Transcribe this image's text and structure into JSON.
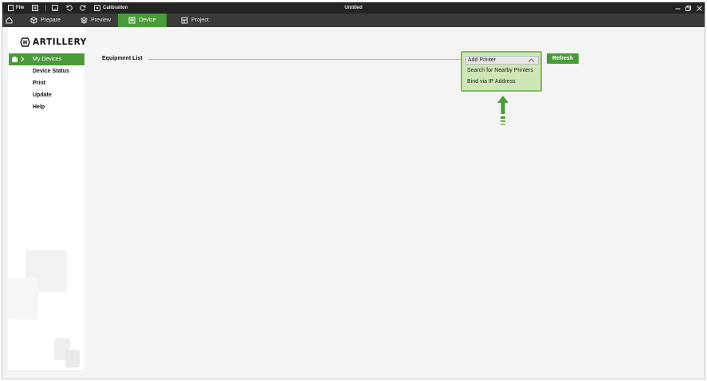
{
  "titlebar": {
    "file_label": "File",
    "calibration_label": "Calibration",
    "app_title": "Untitled"
  },
  "tabs": [
    {
      "label": "Prepare",
      "icon": "cube-icon"
    },
    {
      "label": "Preview",
      "icon": "layers-icon"
    },
    {
      "label": "Device",
      "icon": "device-icon"
    },
    {
      "label": "Project",
      "icon": "project-icon"
    }
  ],
  "active_tab": "Device",
  "sidebar": {
    "logo_text": "ARTILLERY",
    "active_item": "My Devices",
    "items": [
      "Device Status",
      "Print",
      "Update",
      "Help"
    ]
  },
  "main": {
    "equipment_list_label": "Equipment List",
    "refresh_label": "Refresh",
    "add_printer": {
      "label": "Add Printer",
      "options": [
        "Search for Nearby Printers",
        "Bind via IP Address"
      ]
    }
  },
  "colors": {
    "accent": "#4a9a3a",
    "titlebar": "#232323",
    "tabbar": "#3a3a3a",
    "highlight_fill": "#cfe6b6",
    "highlight_border": "#7cc05a"
  }
}
